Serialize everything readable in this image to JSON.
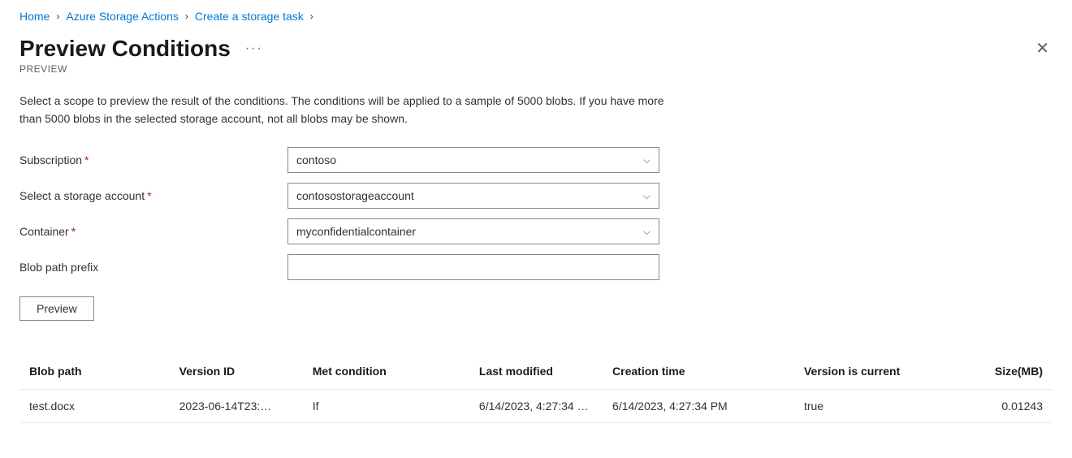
{
  "breadcrumb": {
    "items": [
      "Home",
      "Azure Storage Actions",
      "Create a storage task"
    ]
  },
  "header": {
    "title": "Preview Conditions",
    "subtitle": "PREVIEW"
  },
  "description": "Select a scope to preview the result of the conditions. The conditions will be applied to a sample of 5000 blobs. If you have more than 5000 blobs in the selected storage account, not all blobs may be shown.",
  "form": {
    "subscription": {
      "label": "Subscription",
      "value": "contoso",
      "required": true
    },
    "storage_account": {
      "label": "Select a storage account",
      "value": "contosostorageaccount",
      "required": true
    },
    "container": {
      "label": "Container",
      "value": "myconfidentialcontainer",
      "required": true
    },
    "blob_prefix": {
      "label": "Blob path prefix",
      "value": "",
      "required": false
    }
  },
  "preview_button": "Preview",
  "table": {
    "headers": {
      "blob_path": "Blob path",
      "version_id": "Version ID",
      "met_condition": "Met condition",
      "last_modified": "Last modified",
      "creation_time": "Creation time",
      "version_current": "Version is current",
      "size_mb": "Size(MB)"
    },
    "rows": [
      {
        "blob_path": "test.docx",
        "version_id": "2023-06-14T23:…",
        "met_condition": "If",
        "last_modified": "6/14/2023, 4:27:34 …",
        "creation_time": "6/14/2023, 4:27:34 PM",
        "version_current": "true",
        "size_mb": "0.01243"
      }
    ]
  }
}
